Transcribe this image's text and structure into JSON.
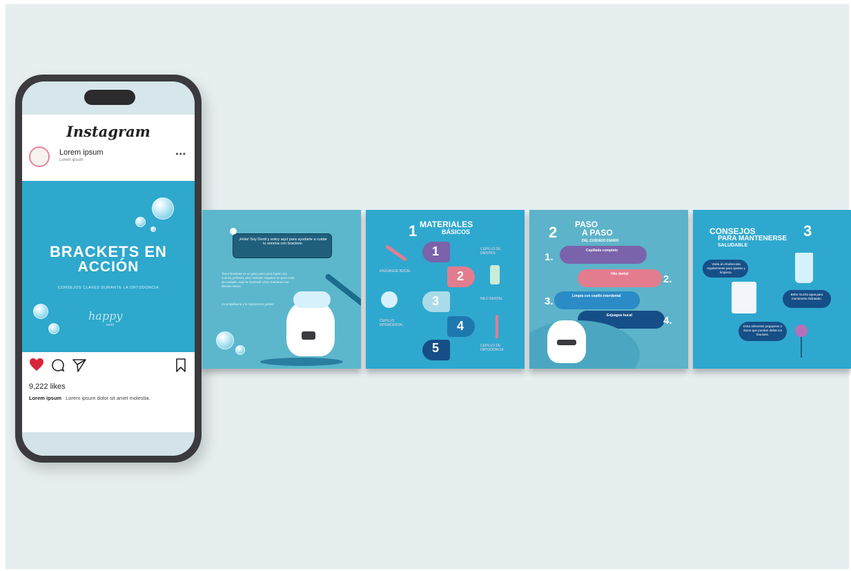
{
  "phone": {
    "app_title": "Instagram",
    "profile": {
      "name": "Lorem ipsum",
      "subtitle": "Lorem ipsum",
      "more": "•••"
    },
    "post": {
      "title_line1": "BRACKETS EN",
      "title_line2": "ACCIÓN",
      "subtitle": "CONSEJOS CLAVES DURANTE LA ORTODONCIA",
      "brand": "happy",
      "brand_sub": "teeth"
    },
    "likes": "9,222 likes",
    "caption": {
      "user": "Lorem ipsum",
      "text": "Lorem ipsum dolor sit amet molestia."
    },
    "icons": {
      "like": "heart-icon",
      "comment": "comment-icon",
      "share": "send-icon",
      "save": "bookmark-icon"
    },
    "colors": {
      "like": "#d9253b",
      "post_bg": "#2ea8cc"
    }
  },
  "slides": {
    "s1": {
      "speech": "¡Hola! Soy Denti y estoy aquí para ayudarte a cuidar tu sonrisa con brackets.",
      "body": "Tener brackets es un gran paso para lograr una sonrisa perfecta, pero también requiere un poco más de cuidado. Aquí te mostraré cómo mantener tus dientes sanos.",
      "footer": "¡Acompáñame y lo lograremos juntos!"
    },
    "s2": {
      "title1": "MATERIALES",
      "title2": "BÁSICOS",
      "section_number": "1",
      "steps": [
        "1",
        "2",
        "3",
        "4",
        "5"
      ],
      "labels": [
        "CEPILLO DE DIENTES",
        "ENJUAGUE BUCAL",
        "HILO DENTAL",
        "CEPILLO INTERDENTAL",
        "CEPILLO DE ORTODONCIA"
      ]
    },
    "s3": {
      "section_number": "2",
      "title1": "PASO",
      "title2": "A PASO",
      "subtitle": "DEL CUIDADO DIARIO",
      "steps": [
        "1.",
        "2.",
        "3.",
        "4."
      ],
      "step_titles": [
        "Cepillado completo",
        "Hilo dental",
        "Limpia con cepillo interdental",
        "Enjuague bucal"
      ]
    },
    "s4": {
      "title1": "CONSEJOS",
      "title2": "PARA MANTENERSE",
      "title3": "SALUDABLE",
      "section_number": "3",
      "tips": [
        "Visita al ortodoncista regularmente para ajustes y limpieza.",
        "Bebe mucha agua para mantenerte hidratado.",
        "Evita alimentos pegajosos o duros que puedan dañar los brackets."
      ]
    }
  }
}
